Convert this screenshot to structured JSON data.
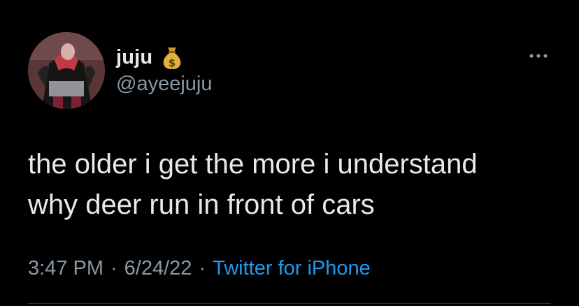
{
  "author": {
    "display_name": "juju",
    "handle": "@ayeejuju",
    "name_emoji": "money-bag-icon"
  },
  "tweet": {
    "text": "the older i get the more i understand\nwhy deer run in front of cars",
    "time": "3:47 PM",
    "date": "6/24/22",
    "separator": "·",
    "source": "Twitter for iPhone"
  },
  "colors": {
    "background": "#000000",
    "primary_text": "#e7e9ea",
    "secondary_text": "#8b98a5",
    "link": "#1d9bf0"
  }
}
